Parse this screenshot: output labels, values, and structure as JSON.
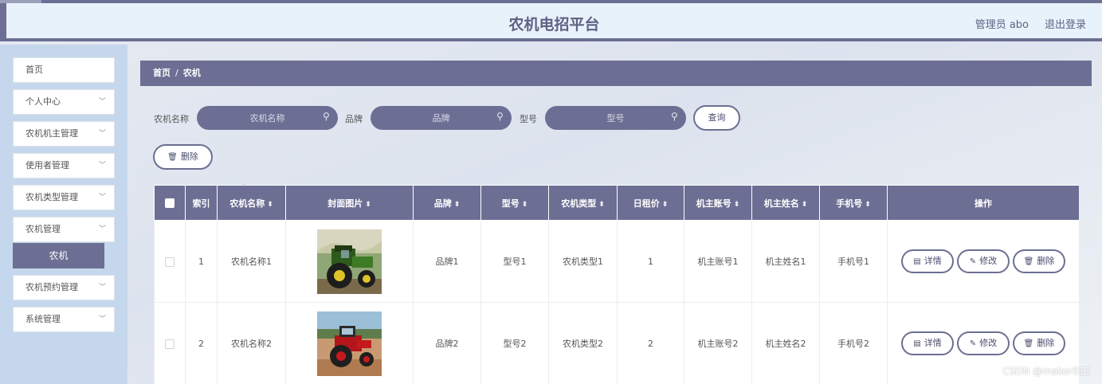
{
  "header": {
    "title": "农机电招平台",
    "user": "管理员 abo",
    "logout": "退出登录"
  },
  "sidebar": {
    "items": [
      {
        "label": "首页",
        "has_chevron": false
      },
      {
        "label": "个人中心",
        "has_chevron": true
      },
      {
        "label": "农机机主管理",
        "has_chevron": true
      },
      {
        "label": "使用者管理",
        "has_chevron": true
      },
      {
        "label": "农机类型管理",
        "has_chevron": true
      },
      {
        "label": "农机管理",
        "has_chevron": true
      },
      {
        "label": "农机预约管理",
        "has_chevron": true
      },
      {
        "label": "系统管理",
        "has_chevron": true
      }
    ],
    "submenu_active": "农机",
    "chevron_icon": "chevron-down-icon"
  },
  "breadcrumb": {
    "home": "首页",
    "separator": "/",
    "current": "农机"
  },
  "search": {
    "name_label": "农机名称",
    "name_placeholder": "农机名称",
    "brand_label": "品牌",
    "brand_placeholder": "品牌",
    "model_label": "型号",
    "model_placeholder": "型号",
    "query_button": "查询"
  },
  "toolbar": {
    "delete_button": "删除"
  },
  "table": {
    "columns": [
      "索引",
      "农机名称",
      "封面图片",
      "品牌",
      "型号",
      "农机类型",
      "日租价",
      "机主账号",
      "机主姓名",
      "手机号",
      "操作"
    ],
    "rows": [
      {
        "index": "1",
        "name": "农机名称1",
        "image": "green-tractor",
        "brand": "品牌1",
        "model": "型号1",
        "type": "农机类型1",
        "price": "1",
        "owner_account": "机主账号1",
        "owner_name": "机主姓名1",
        "phone": "手机号1"
      },
      {
        "index": "2",
        "name": "农机名称2",
        "image": "red-tractor",
        "brand": "品牌2",
        "model": "型号2",
        "type": "农机类型2",
        "price": "2",
        "owner_account": "机主账号2",
        "owner_name": "机主姓名2",
        "phone": "手机号2"
      }
    ],
    "actions": {
      "detail": "详情",
      "edit": "修改",
      "delete": "删除"
    }
  },
  "watermark": "CSDN @maker011",
  "colors": {
    "accent": "#6c6f93",
    "header_bg": "#e8f2fb",
    "sidebar_bg": "#c5d7ec"
  }
}
